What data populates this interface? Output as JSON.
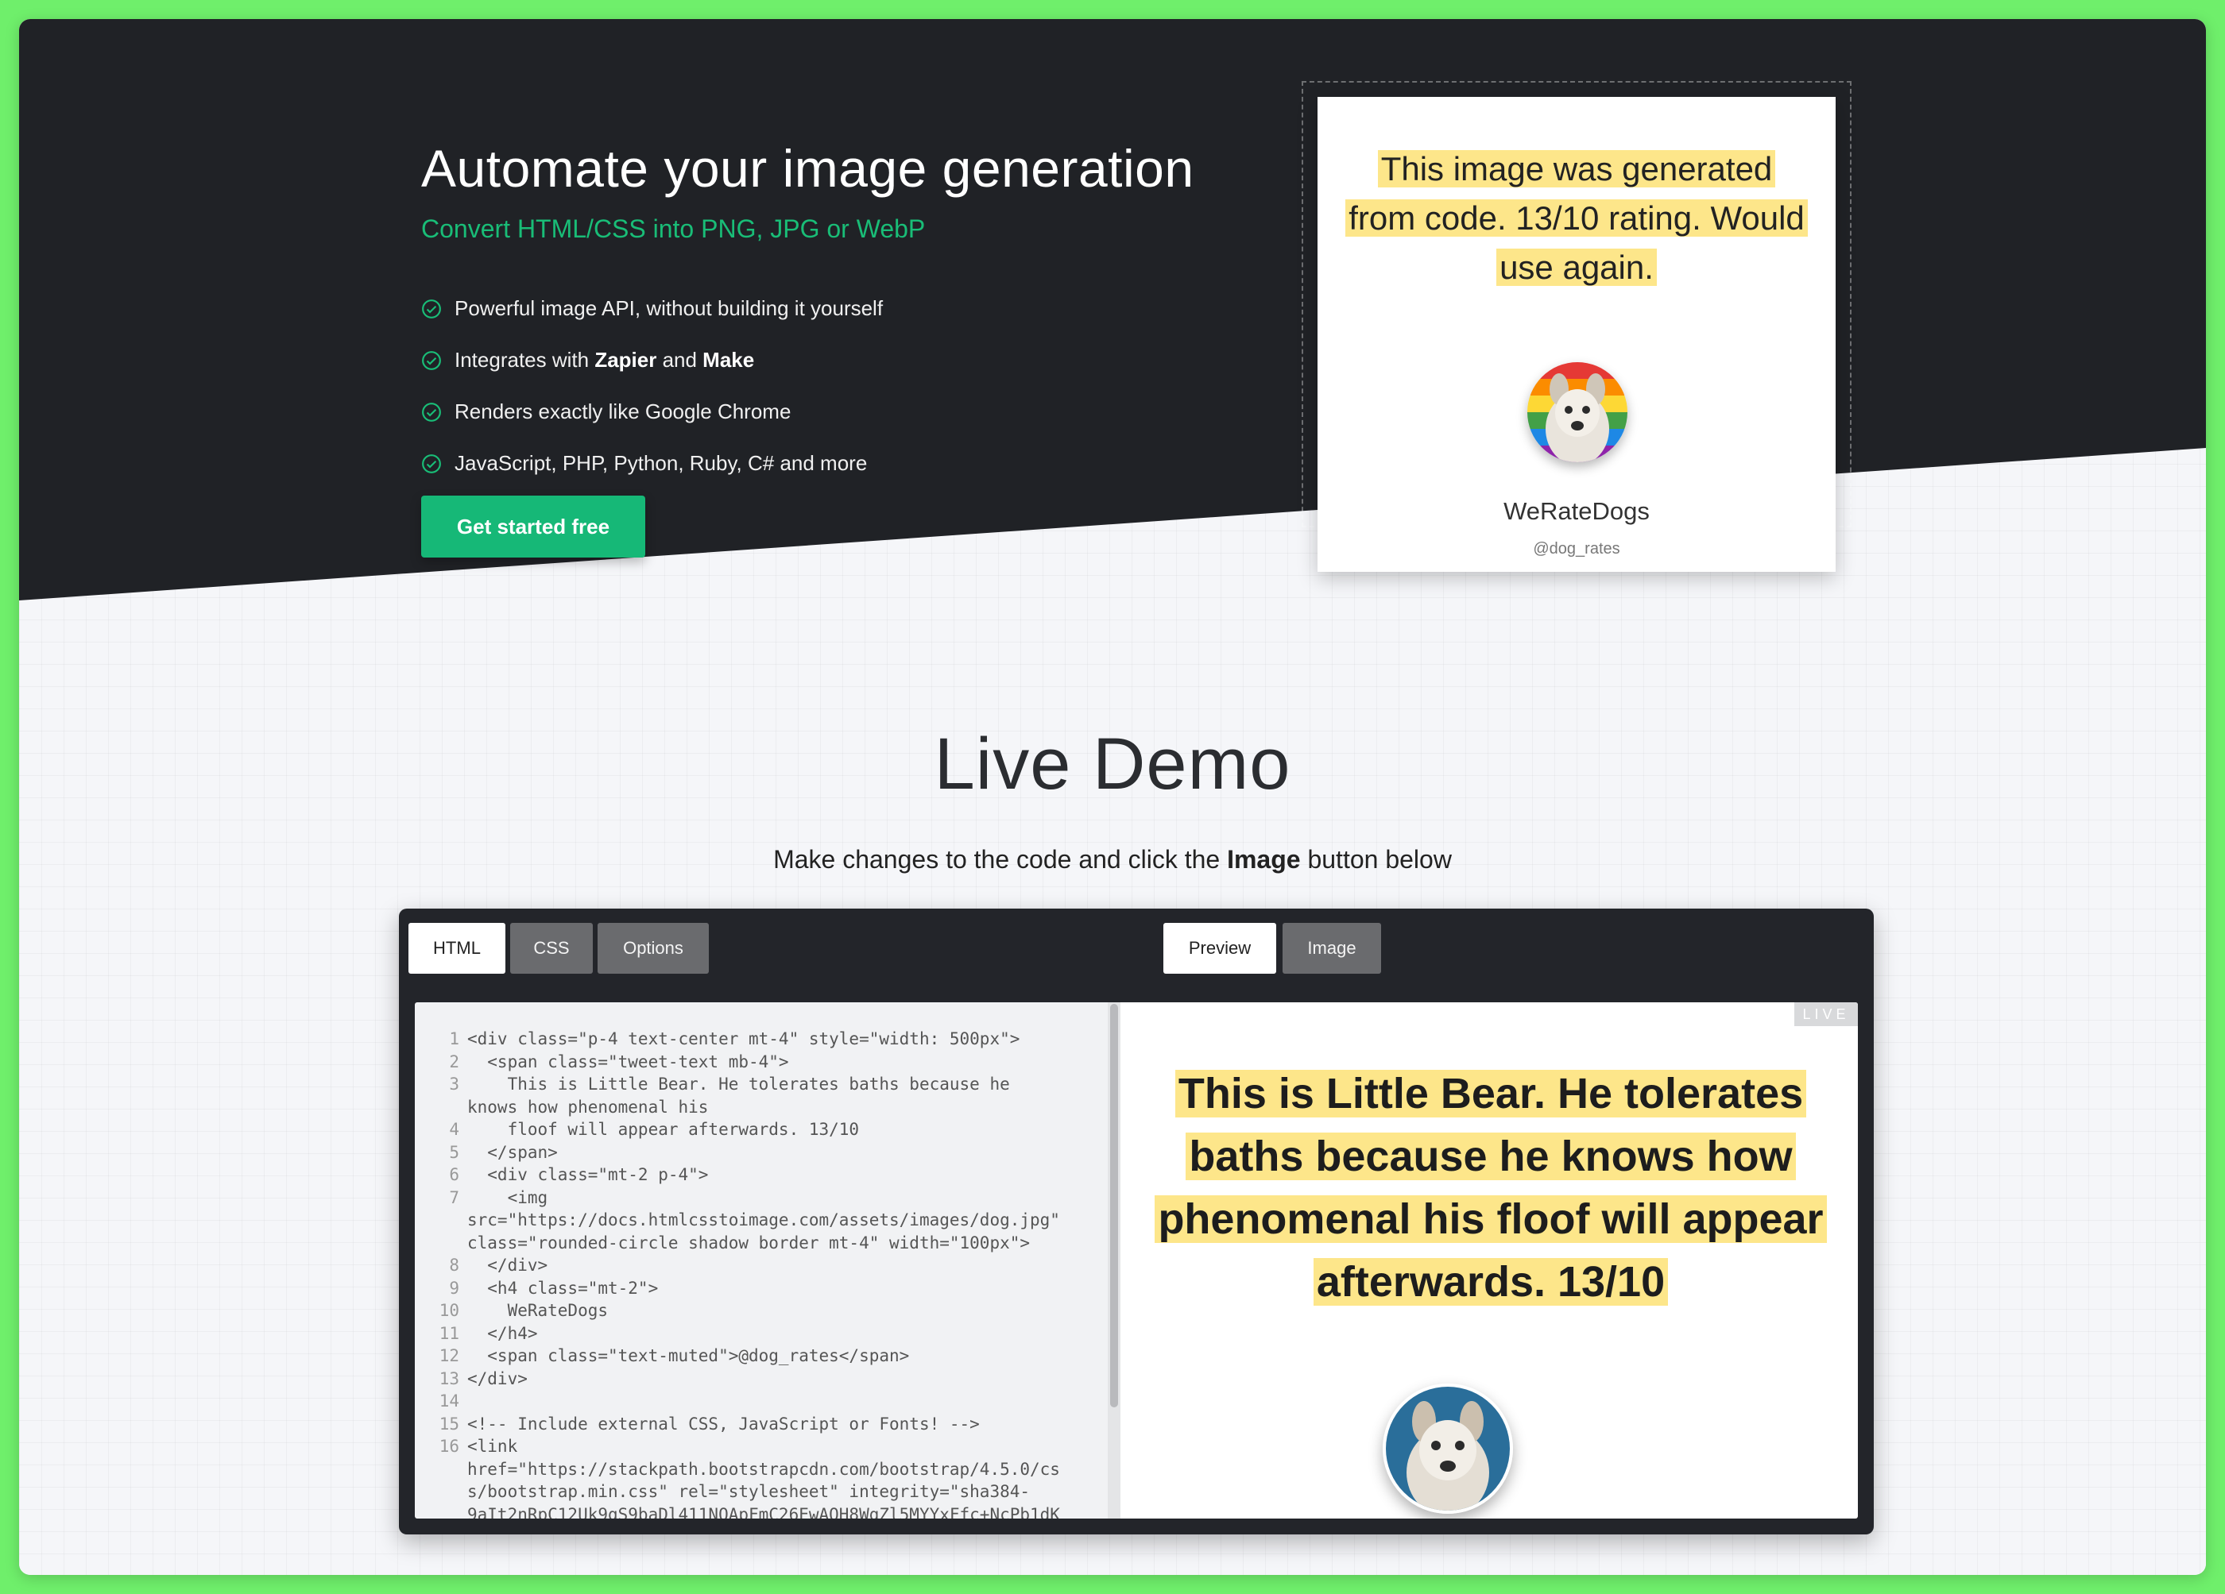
{
  "hero": {
    "title": "Automate your image generation",
    "subtitle": "Convert HTML/CSS into PNG, JPG or WebP",
    "features": [
      {
        "pre": "Powerful image API, without building it yourself",
        "b1": "",
        "mid": "",
        "b2": ""
      },
      {
        "pre": "Integrates with ",
        "b1": "Zapier",
        "mid": " and ",
        "b2": "Make"
      },
      {
        "pre": "Renders exactly like Google Chrome",
        "b1": "",
        "mid": "",
        "b2": ""
      },
      {
        "pre": "JavaScript, PHP, Python, Ruby, C# and more",
        "b1": "",
        "mid": "",
        "b2": ""
      }
    ],
    "cta_label": "Get started free",
    "sample": {
      "quote": "This image was generated from code. 13/10 rating. Would use again.",
      "name": "WeRateDogs",
      "handle": "@dog_rates"
    }
  },
  "demo": {
    "title": "Live Demo",
    "sub_pre": "Make changes to the code and click the ",
    "sub_bold": "Image",
    "sub_post": " button below",
    "tabs_left": [
      "HTML",
      "CSS",
      "Options"
    ],
    "tabs_right": [
      "Preview",
      "Image"
    ],
    "live_badge": "LIVE",
    "code": [
      {
        "n": "1",
        "t": "<div class=\"p-4 text-center mt-4\" style=\"width: 500px\">"
      },
      {
        "n": "2",
        "t": "  <span class=\"tweet-text mb-4\">"
      },
      {
        "n": "3",
        "t": "    This is Little Bear. He tolerates baths because he"
      },
      {
        "n": "",
        "t": "knows how phenomenal his"
      },
      {
        "n": "4",
        "t": "    floof will appear afterwards. 13/10"
      },
      {
        "n": "5",
        "t": "  </span>"
      },
      {
        "n": "6",
        "t": "  <div class=\"mt-2 p-4\">"
      },
      {
        "n": "7",
        "t": "    <img"
      },
      {
        "n": "",
        "t": "src=\"https://docs.htmlcsstoimage.com/assets/images/dog.jpg\""
      },
      {
        "n": "",
        "t": "class=\"rounded-circle shadow border mt-4\" width=\"100px\">"
      },
      {
        "n": "8",
        "t": "  </div>"
      },
      {
        "n": "9",
        "t": "  <h4 class=\"mt-2\">"
      },
      {
        "n": "10",
        "t": "    WeRateDogs"
      },
      {
        "n": "11",
        "t": "  </h4>"
      },
      {
        "n": "12",
        "t": "  <span class=\"text-muted\">@dog_rates</span>"
      },
      {
        "n": "13",
        "t": "</div>"
      },
      {
        "n": "14",
        "t": ""
      },
      {
        "n": "15",
        "t": "<!-- Include external CSS, JavaScript or Fonts! -->"
      },
      {
        "n": "16",
        "t": "<link"
      },
      {
        "n": "",
        "t": "href=\"https://stackpath.bootstrapcdn.com/bootstrap/4.5.0/cs"
      },
      {
        "n": "",
        "t": "s/bootstrap.min.css\" rel=\"stylesheet\" integrity=\"sha384-"
      },
      {
        "n": "",
        "t": "9aIt2nRpC12Uk9gS9baDl411NQApFmC26EwAOH8WgZl5MYYxFfc+NcPb1dK"
      }
    ],
    "preview_quote": "This is Little Bear. He tolerates baths because he knows how phenomenal his floof will appear afterwards. 13/10"
  },
  "colors": {
    "page_border": "#6fef6b",
    "hero_bg": "#202226",
    "accent": "#16b877",
    "highlight": "#fde68a",
    "editor_bg": "#23252a"
  }
}
